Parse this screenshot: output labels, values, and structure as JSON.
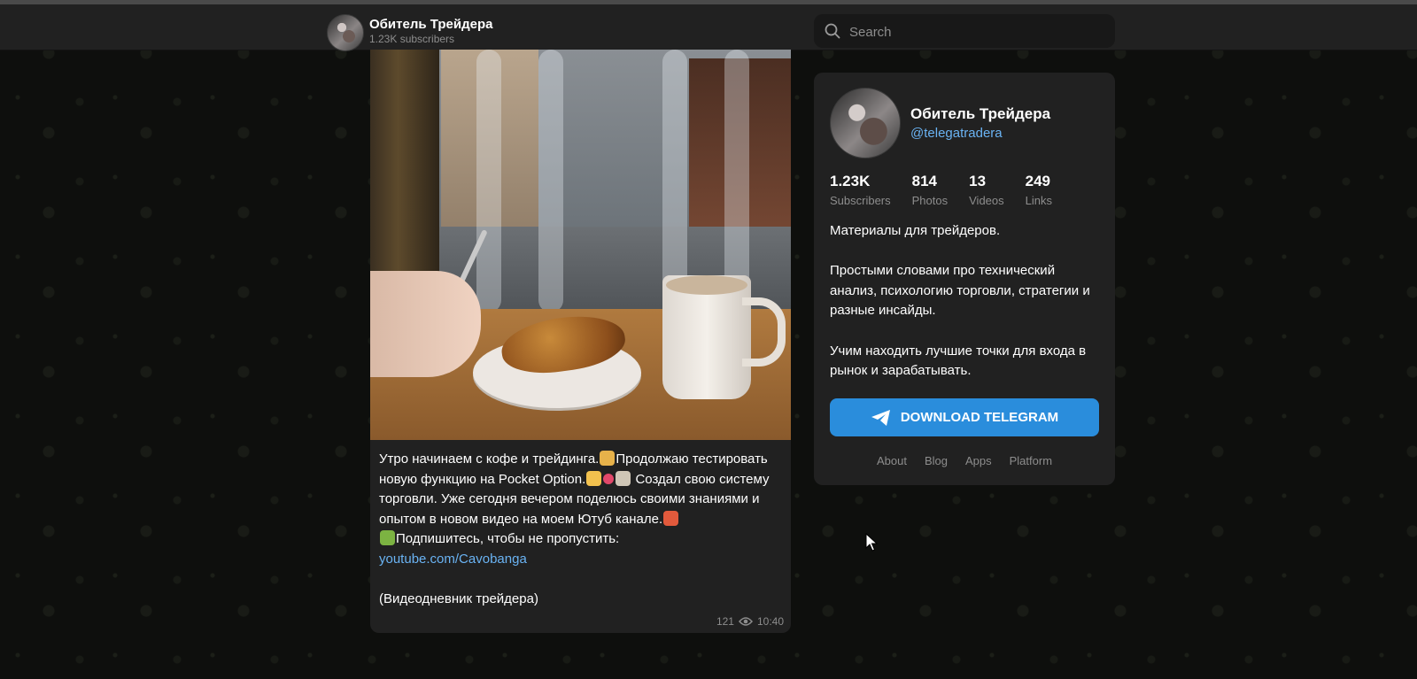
{
  "header": {
    "channel_title": "Обитель Трейдера",
    "subscribers": "1.23K subscribers",
    "avatar_icon": "channel-avatar",
    "search_placeholder": "Search",
    "search_icon": "search-icon"
  },
  "post": {
    "paragraphs": [
      "Утро начинаем с кофе и трейдинга.",
      "Продолжаю тестировать новую функцию на Pocket Option.",
      "Создал свою систему торговли. Уже сегодня вечером поделюсь своими знаниями и опытом в новом видео на моем Ютуб канале.",
      "Подпишитесь, чтобы не пропустить:"
    ],
    "link": "youtube.com/Cavobanga",
    "footer_text": "(Видеодневник трейдера)",
    "views": "121",
    "time": "10:40"
  },
  "sidebar": {
    "title": "Обитель Трейдера",
    "username": "@telegatradera",
    "stats": [
      {
        "value": "1.23K",
        "label": "Subscribers"
      },
      {
        "value": "814",
        "label": "Photos"
      },
      {
        "value": "13",
        "label": "Videos"
      },
      {
        "value": "249",
        "label": "Links"
      }
    ],
    "description": [
      "Материалы для трейдеров.",
      "Простыми словами про технический анализ, психологию торговли, стратегии и разные инсайды.",
      "Учим находить лучшие точки для входа в рынок и зарабатывать."
    ],
    "download_button": "DOWNLOAD TELEGRAM",
    "footer_links": [
      "About",
      "Blog",
      "Apps",
      "Platform"
    ]
  },
  "colors": {
    "accent": "#2a8ddc",
    "link": "#6ab3f3",
    "panel": "#212121",
    "muted": "#8d8d8d"
  }
}
